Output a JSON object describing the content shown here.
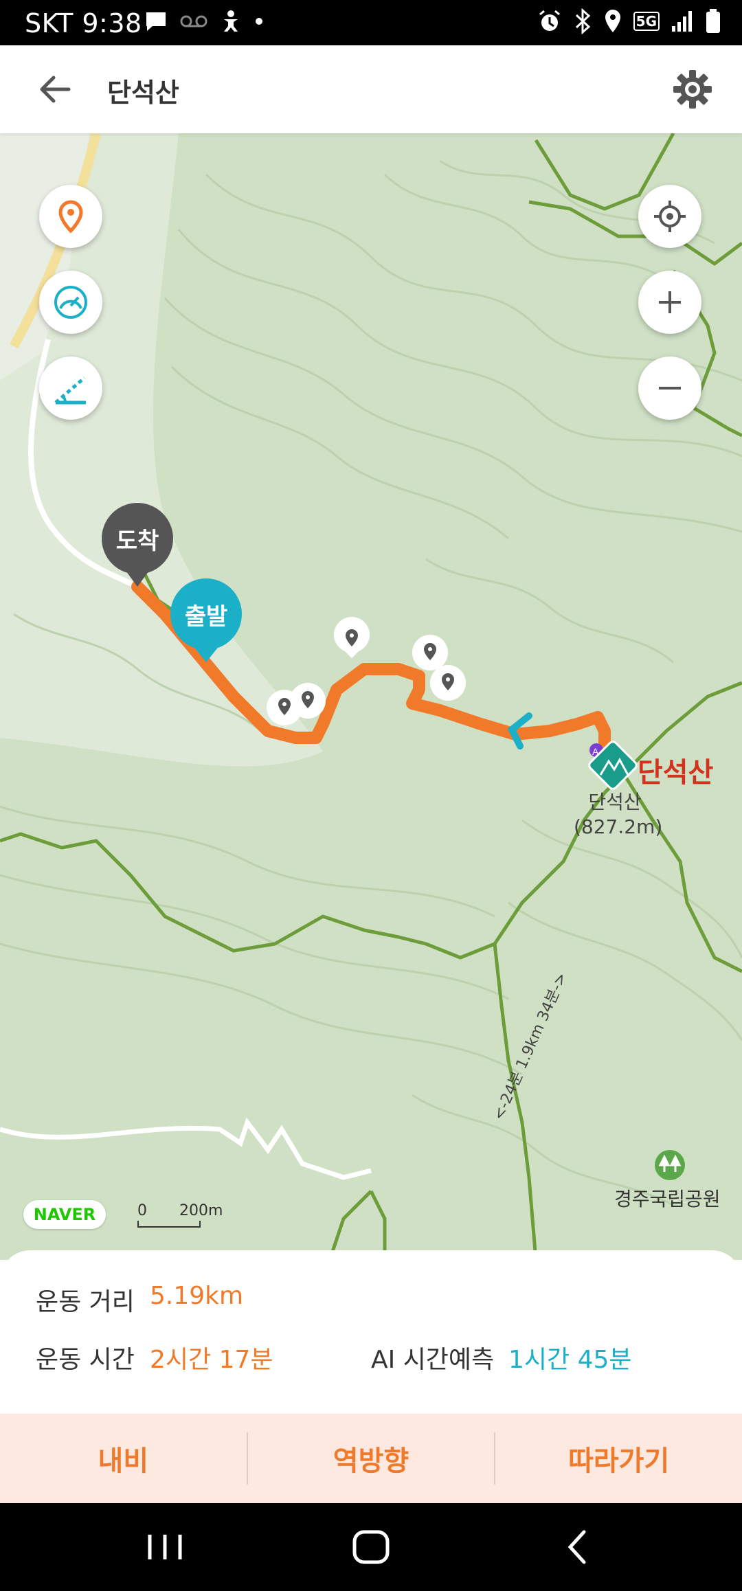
{
  "status_bar": {
    "carrier_time": "SKT 9:38",
    "icons": [
      "message-icon",
      "voicemail-icon",
      "accessibility-icon",
      "dot-icon",
      "alarm-icon",
      "bluetooth-icon",
      "location-icon",
      "5g-icon",
      "signal-icon",
      "battery-icon"
    ],
    "network": "5G"
  },
  "header": {
    "title": "단석산",
    "back_icon": "arrow-left-icon",
    "settings_icon": "gear-icon"
  },
  "map": {
    "left_buttons": [
      "location-pin-icon",
      "speedometer-icon",
      "slope-icon"
    ],
    "right_buttons": [
      "my-location-icon",
      "zoom-in-icon",
      "zoom-out-icon"
    ],
    "pins": {
      "arrival": "도착",
      "departure": "출발"
    },
    "peak": {
      "name": "단석산",
      "sub_name": "단석산",
      "elevation": "(827.2m)"
    },
    "trail_note": "<-24분 1.9km 34분->",
    "park": "경주국립공원",
    "brand": "NAVER",
    "scale": {
      "zero": "0",
      "distance": "200m"
    },
    "colors": {
      "route": "#f07a2a",
      "trail": "#6d9d3a",
      "departure_pin": "#1bb0c8",
      "arrival_pin": "#555555"
    }
  },
  "stats": {
    "distance_label": "운동 거리",
    "distance_value": "5.19km",
    "time_label": "운동 시간",
    "time_value": "2시간 17분",
    "ai_label": "AI 시간예측",
    "ai_value": "1시간 45분"
  },
  "actions": {
    "navi": "내비",
    "reverse": "역방향",
    "follow": "따라가기"
  },
  "nav_bar": [
    "recents-icon",
    "home-icon",
    "back-icon"
  ]
}
